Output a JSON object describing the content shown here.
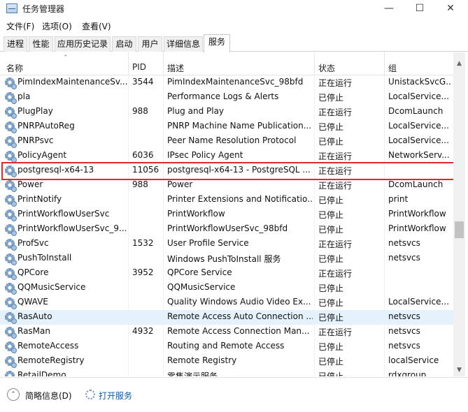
{
  "window": {
    "title": "任务管理器",
    "minimize": "—",
    "maximize": "☐",
    "close": "✕"
  },
  "menu": [
    "文件(F)",
    "选项(O)",
    "查看(V)"
  ],
  "tabs": [
    "进程",
    "性能",
    "应用历史记录",
    "启动",
    "用户",
    "详细信息",
    "服务"
  ],
  "active_tab": 6,
  "columns": {
    "name": "名称",
    "pid": "PID",
    "desc": "描述",
    "status": "状态",
    "group": "组"
  },
  "rows": [
    {
      "name": "PimIndexMaintenanceSv...",
      "pid": "3544",
      "desc": "PimIndexMaintenanceSvc_98bfd",
      "status": "正在运行",
      "group": "UnistackSvcG..."
    },
    {
      "name": "pla",
      "pid": "",
      "desc": "Performance Logs & Alerts",
      "status": "已停止",
      "group": "LocalService..."
    },
    {
      "name": "PlugPlay",
      "pid": "988",
      "desc": "Plug and Play",
      "status": "正在运行",
      "group": "DcomLaunch"
    },
    {
      "name": "PNRPAutoReg",
      "pid": "",
      "desc": "PNRP Machine Name Publication...",
      "status": "已停止",
      "group": "LocalService..."
    },
    {
      "name": "PNRPsvc",
      "pid": "",
      "desc": "Peer Name Resolution Protocol",
      "status": "已停止",
      "group": "LocalService..."
    },
    {
      "name": "PolicyAgent",
      "pid": "6036",
      "desc": "IPsec Policy Agent",
      "status": "正在运行",
      "group": "NetworkServ..."
    },
    {
      "name": "postgresql-x64-13",
      "pid": "11056",
      "desc": "postgresql-x64-13 - PostgreSQL ...",
      "status": "正在运行",
      "group": ""
    },
    {
      "name": "Power",
      "pid": "988",
      "desc": "Power",
      "status": "正在运行",
      "group": "DcomLaunch"
    },
    {
      "name": "PrintNotify",
      "pid": "",
      "desc": "Printer Extensions and Notificatio...",
      "status": "已停止",
      "group": "print"
    },
    {
      "name": "PrintWorkflowUserSvc",
      "pid": "",
      "desc": "PrintWorkflow",
      "status": "已停止",
      "group": "PrintWorkflow"
    },
    {
      "name": "PrintWorkflowUserSvc_9...",
      "pid": "",
      "desc": "PrintWorkflowUserSvc_98bfd",
      "status": "已停止",
      "group": "PrintWorkflow"
    },
    {
      "name": "ProfSvc",
      "pid": "1532",
      "desc": "User Profile Service",
      "status": "正在运行",
      "group": "netsvcs"
    },
    {
      "name": "PushToInstall",
      "pid": "",
      "desc": "Windows PushToInstall 服务",
      "status": "已停止",
      "group": "netsvcs"
    },
    {
      "name": "QPCore",
      "pid": "3952",
      "desc": "QPCore Service",
      "status": "正在运行",
      "group": ""
    },
    {
      "name": "QQMusicService",
      "pid": "",
      "desc": "QQMusicService",
      "status": "已停止",
      "group": ""
    },
    {
      "name": "QWAVE",
      "pid": "",
      "desc": "Quality Windows Audio Video Ex...",
      "status": "已停止",
      "group": "LocalService..."
    },
    {
      "name": "RasAuto",
      "pid": "",
      "desc": "Remote Access Auto Connection ...",
      "status": "已停止",
      "group": "netsvcs"
    },
    {
      "name": "RasMan",
      "pid": "4932",
      "desc": "Remote Access Connection Man...",
      "status": "正在运行",
      "group": "netsvcs"
    },
    {
      "name": "RemoteAccess",
      "pid": "",
      "desc": "Routing and Remote Access",
      "status": "已停止",
      "group": "netsvcs"
    },
    {
      "name": "RemoteRegistry",
      "pid": "",
      "desc": "Remote Registry",
      "status": "已停止",
      "group": "localService"
    },
    {
      "name": "RetailDemo",
      "pid": "",
      "desc": "零售演示服务",
      "status": "已停止",
      "group": "rdxgroup"
    }
  ],
  "status_bar": {
    "brief": "简略信息(D)",
    "open_services": "打开服务"
  }
}
